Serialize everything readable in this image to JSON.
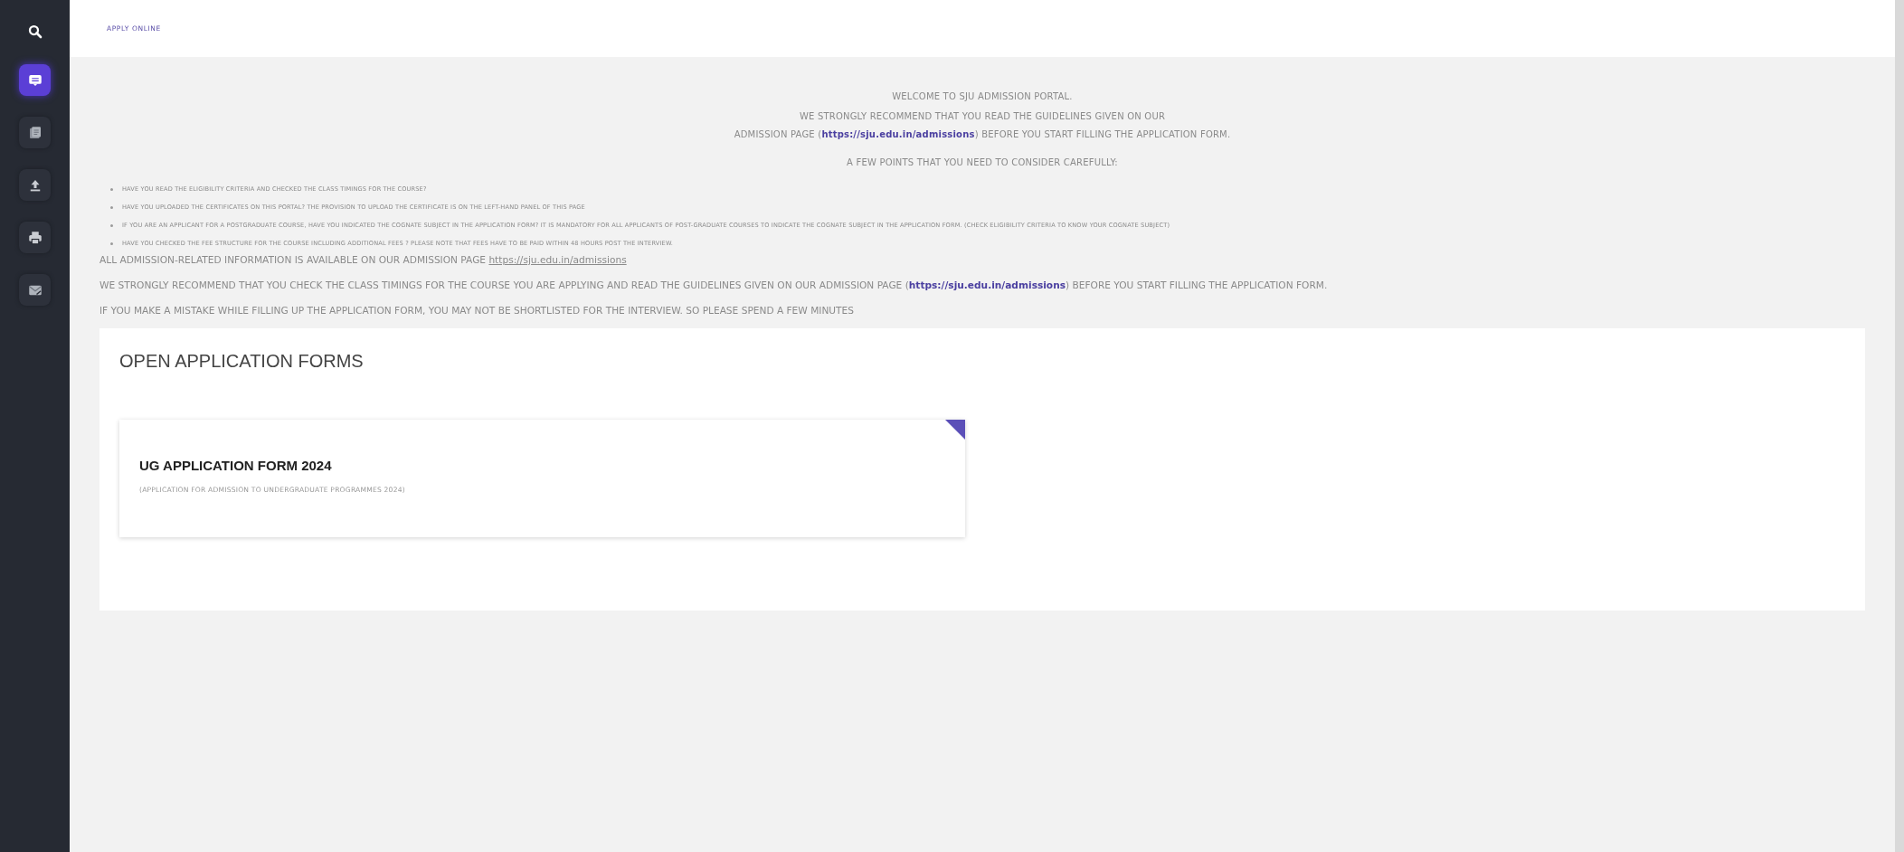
{
  "sidebar": {
    "items": [
      {
        "kind": "message",
        "selected": true
      },
      {
        "kind": "document",
        "selected": false
      },
      {
        "kind": "upload",
        "selected": false
      },
      {
        "kind": "print",
        "selected": false
      },
      {
        "kind": "mail",
        "selected": false
      }
    ]
  },
  "header": {
    "title": "APPLY ONLINE"
  },
  "notice": {
    "welcome": "WELCOME TO SJU ADMISSION PORTAL.",
    "intro": [
      [
        {
          "kind": "text",
          "text": "WE STRONGLY RECOMMEND THAT YOU READ THE GUIDELINES GIVEN ON OUR"
        }
      ],
      [
        {
          "kind": "text",
          "text": "ADMISSION PAGE ("
        },
        {
          "kind": "link",
          "text": "https://sju.edu.in/admissions"
        },
        {
          "kind": "text",
          "text": ") BEFORE YOU START FILLING THE APPLICATION FORM."
        }
      ]
    ],
    "points_heading": "A FEW POINTS THAT YOU NEED TO CONSIDER CAREFULLY:",
    "points": [
      "HAVE YOU READ THE ELIGIBILITY CRITERIA AND CHECKED THE CLASS TIMINGS  FOR THE COURSE?",
      "HAVE YOU UPLOADED THE CERTIFICATES ON THIS PORTAL? THE PROVISION TO UPLOAD THE CERTIFICATE IS ON THE LEFT-HAND PANEL OF THIS PAGE",
      "IF YOU ARE AN APPLICANT FOR A POSTGRADUATE COURSE, HAVE YOU INDICATED THE COGNATE SUBJECT IN THE APPLICATION FORM? IT IS MANDATORY FOR ALL APPLICANTS OF POST-GRADUATE COURSES TO INDICATE THE COGNATE SUBJECT IN THE APPLICATION FORM. (CHECK ELIGIBILITY CRITERIA TO KNOW YOUR COGNATE SUBJECT)",
      "HAVE YOU CHECKED THE FEE STRUCTURE FOR THE COURSE INCLUDING ADDITIONAL FEES ? PLEASE NOTE THAT FEES HAVE TO BE PAID WITHIN 48 HOURS POST THE INTERVIEW."
    ],
    "notes": [
      [
        {
          "kind": "text",
          "text": "ALL ADMISSION-RELATED INFORMATION IS AVAILABLE ON OUR ADMISSION PAGE "
        },
        {
          "kind": "plain_link",
          "text": "https://sju.edu.in/admissions"
        }
      ],
      [
        {
          "kind": "text",
          "text": "WE STRONGLY RECOMMEND THAT YOU CHECK THE CLASS TIMINGS FOR THE COURSE YOU ARE APPLYING AND READ THE GUIDELINES GIVEN ON OUR ADMISSION PAGE ("
        },
        {
          "kind": "link",
          "text": "https://sju.edu.in/admissions"
        },
        {
          "kind": "text",
          "text": ") BEFORE YOU START FILLING THE APPLICATION FORM."
        }
      ],
      [
        {
          "kind": "text",
          "text": "IF YOU MAKE A MISTAKE WHILE FILLING UP THE APPLICATION FORM, YOU MAY NOT BE SHORTLISTED FOR THE INTERVIEW. SO PLEASE SPEND A FEW MINUTES"
        }
      ]
    ]
  },
  "forms": {
    "title": "OPEN APPLICATION FORMS",
    "cards": [
      {
        "title": "UG APPLICATION FORM 2024",
        "subtitle": "(APPLICATION FOR ADMISSION TO UNDERGRADUATE PROGRAMMES 2024)"
      }
    ]
  }
}
